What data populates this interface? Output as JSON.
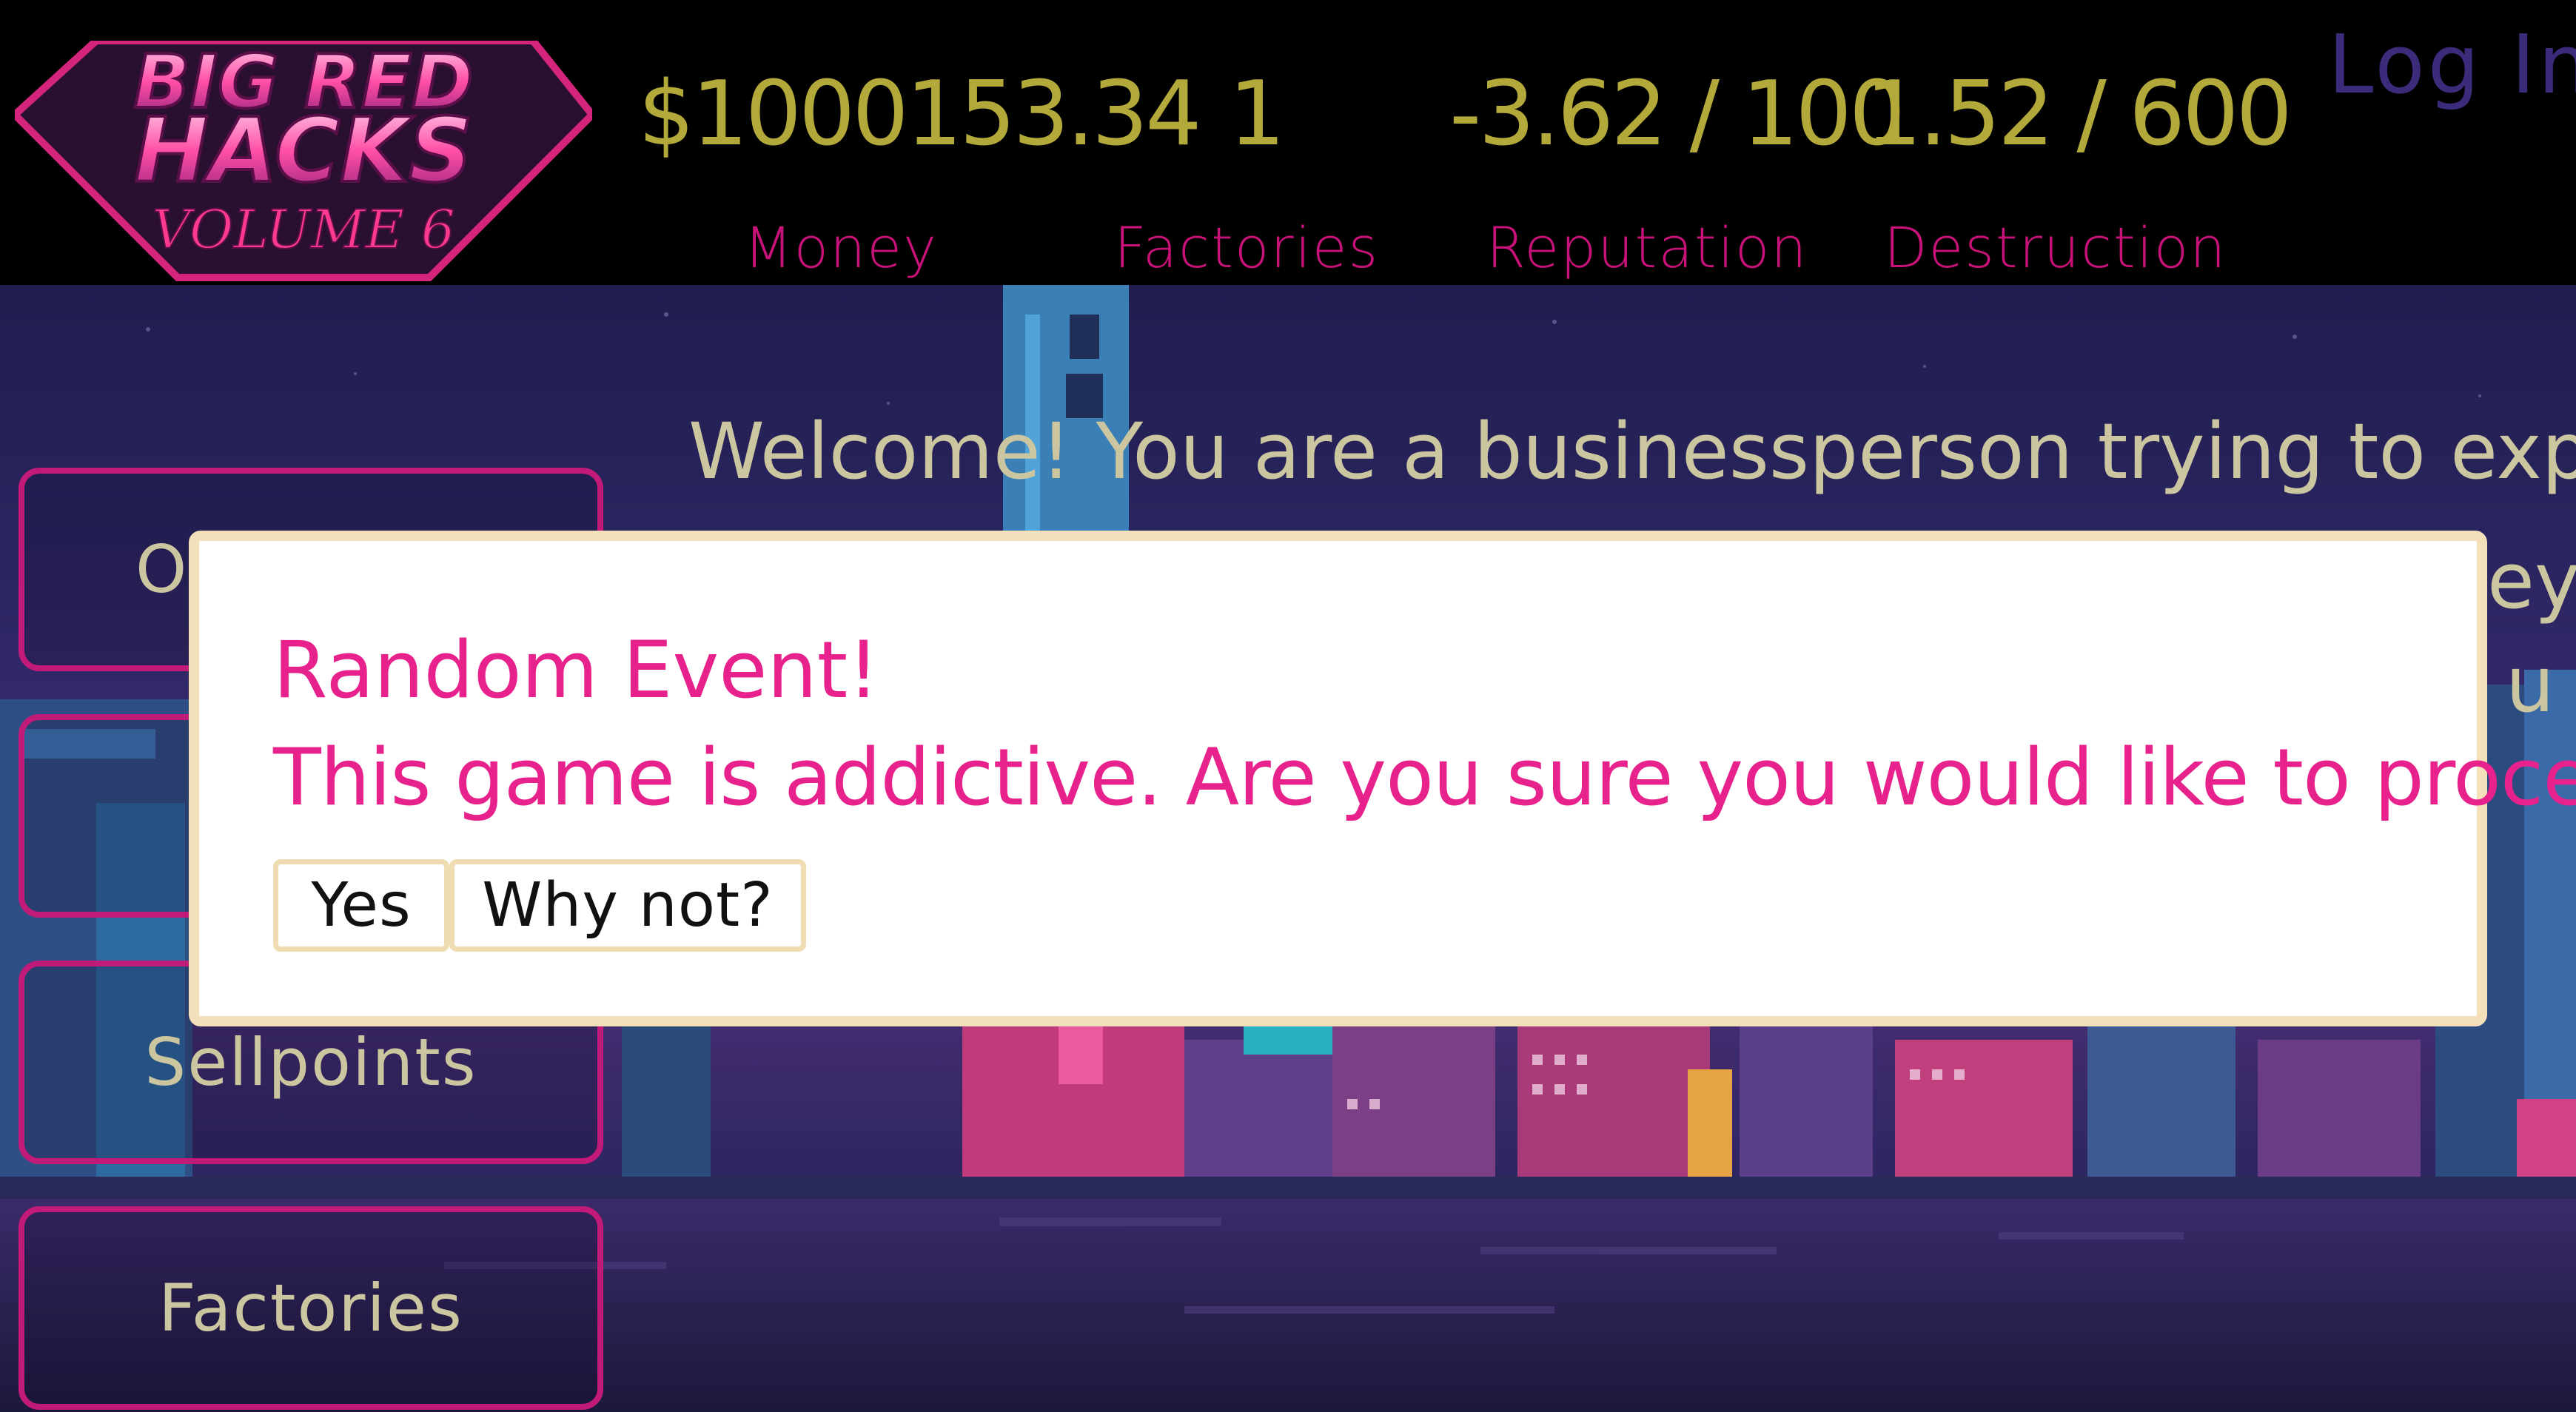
{
  "header": {
    "logo_text": {
      "line1": "BIG RED",
      "line2": "HACKS",
      "line3": "VOLUME 6"
    },
    "stats": [
      {
        "value": "$1000153.34",
        "label": "Money"
      },
      {
        "value": "1",
        "label": "Factories"
      },
      {
        "value": "-3.62 / 100",
        "label": "Reputation"
      },
      {
        "value": "1.52 / 600",
        "label": "Destruction"
      }
    ],
    "login_label": "Log In"
  },
  "main": {
    "welcome_text": "Welcome! You are a businessperson trying to expand your",
    "peek_right_1": "ey",
    "peek_right_2": "u"
  },
  "sidebar": {
    "items": [
      {
        "label": "O"
      },
      {
        "label": ""
      },
      {
        "label": "Sellpoints"
      },
      {
        "label": "Factories"
      }
    ]
  },
  "modal": {
    "title": "Random Event!",
    "message": "This game is addictive. Are you sure you would like to proceed?",
    "buttons": [
      {
        "label": "Yes"
      },
      {
        "label": "Why not?"
      }
    ]
  },
  "colors": {
    "stat_value": "#b3a83a",
    "stat_label": "#c8127a",
    "modal_text": "#e8228c",
    "modal_border": "#f3dfb9",
    "sidebar_border": "#c21a78"
  }
}
